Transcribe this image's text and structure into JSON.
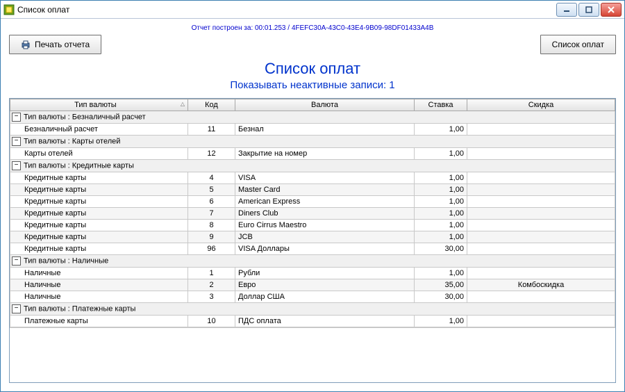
{
  "window": {
    "title": "Список оплат"
  },
  "report": {
    "info_prefix": "Отчет построен за:",
    "info_time": "00:01.253",
    "info_sep": "/",
    "info_guid": "4FEFC30A-43C0-43E4-9B09-98DF01433A4B"
  },
  "toolbar": {
    "print_label": "Печать отчета",
    "list_label": "Список оплат"
  },
  "page": {
    "title": "Список оплат",
    "subtitle": "Показывать неактивные записи: 1"
  },
  "columns": {
    "currency_type": "Тип валюты",
    "code": "Код",
    "currency": "Валюта",
    "rate": "Ставка",
    "discount": "Скидка"
  },
  "groups": [
    {
      "header": "Тип валюты : Безналичный расчет",
      "rows": [
        {
          "type": "Безналичный расчет",
          "code": "11",
          "currency": "Безнал",
          "rate": "1,00",
          "discount": ""
        }
      ]
    },
    {
      "header": "Тип валюты : Карты отелей",
      "rows": [
        {
          "type": "Карты отелей",
          "code": "12",
          "currency": "Закрытие на номер",
          "rate": "1,00",
          "discount": ""
        }
      ]
    },
    {
      "header": "Тип валюты : Кредитные карты",
      "rows": [
        {
          "type": "Кредитные карты",
          "code": "4",
          "currency": "VISA",
          "rate": "1,00",
          "discount": ""
        },
        {
          "type": "Кредитные карты",
          "code": "5",
          "currency": "Master Card",
          "rate": "1,00",
          "discount": ""
        },
        {
          "type": "Кредитные карты",
          "code": "6",
          "currency": "American Express",
          "rate": "1,00",
          "discount": ""
        },
        {
          "type": "Кредитные карты",
          "code": "7",
          "currency": "Diners Club",
          "rate": "1,00",
          "discount": ""
        },
        {
          "type": "Кредитные карты",
          "code": "8",
          "currency": "Euro Cirrus Maestro",
          "rate": "1,00",
          "discount": ""
        },
        {
          "type": "Кредитные карты",
          "code": "9",
          "currency": "JCB",
          "rate": "1,00",
          "discount": ""
        },
        {
          "type": "Кредитные карты",
          "code": "96",
          "currency": "VISA Доллары",
          "rate": "30,00",
          "discount": ""
        }
      ]
    },
    {
      "header": "Тип валюты : Наличные",
      "rows": [
        {
          "type": "Наличные",
          "code": "1",
          "currency": "Рубли",
          "rate": "1,00",
          "discount": ""
        },
        {
          "type": "Наличные",
          "code": "2",
          "currency": "Евро",
          "rate": "35,00",
          "discount": "Комбоскидка"
        },
        {
          "type": "Наличные",
          "code": "3",
          "currency": "Доллар США",
          "rate": "30,00",
          "discount": ""
        }
      ]
    },
    {
      "header": "Тип валюты : Платежные карты",
      "rows": [
        {
          "type": "Платежные карты",
          "code": "10",
          "currency": "ПДС оплата",
          "rate": "1,00",
          "discount": ""
        }
      ]
    }
  ]
}
